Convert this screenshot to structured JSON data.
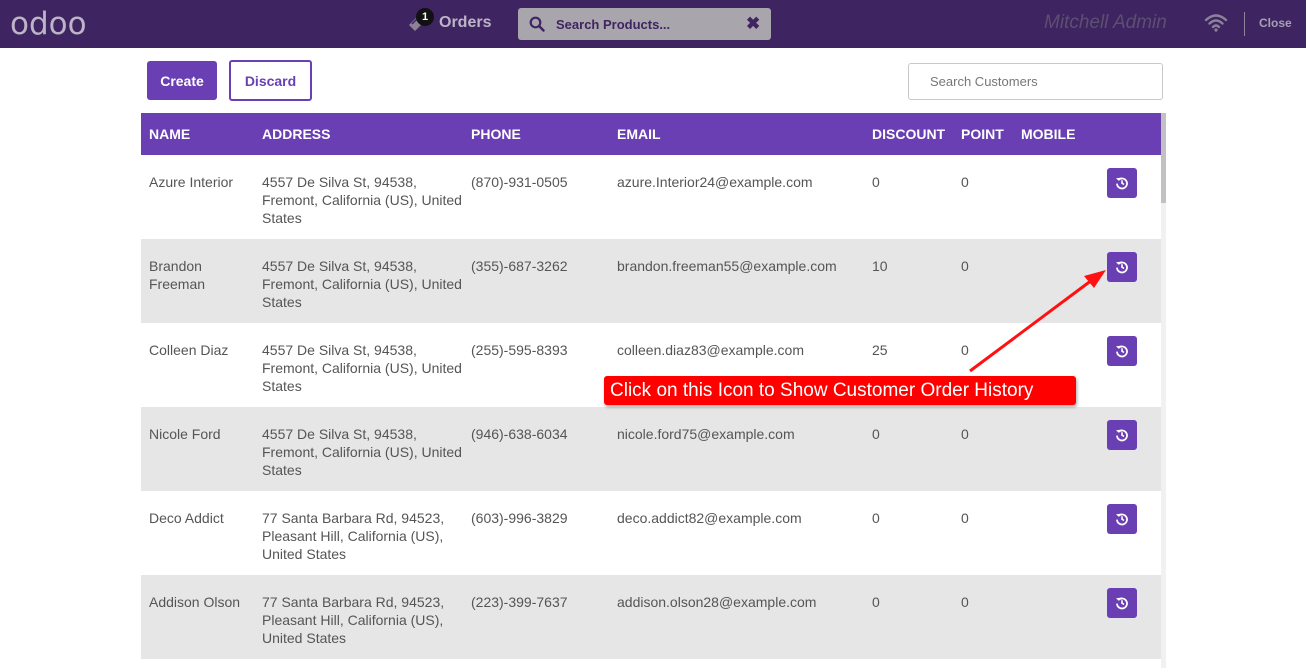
{
  "topbar": {
    "logo": "odoo",
    "orders_count": "1",
    "orders_label": "Orders",
    "search_products_placeholder": "Search Products...",
    "cashier": "Mitchell Admin",
    "close_label": "Close"
  },
  "controls": {
    "create_label": "Create",
    "discard_label": "Discard",
    "search_customers_placeholder": "Search Customers"
  },
  "table": {
    "headers": [
      "NAME",
      "ADDRESS",
      "PHONE",
      "EMAIL",
      "DISCOUNT",
      "POINT",
      "MOBILE"
    ],
    "rows": [
      {
        "name": "Azure Interior",
        "address": "4557 De Silva St, 94538, Fremont, California (US), United States",
        "phone": "(870)-931-0505",
        "email": "azure.Interior24@example.com",
        "discount": "0",
        "point": "0",
        "mobile": ""
      },
      {
        "name": "Brandon Freeman",
        "address": "4557 De Silva St, 94538, Fremont, California (US), United States",
        "phone": "(355)-687-3262",
        "email": "brandon.freeman55@example.com",
        "discount": "10",
        "point": "0",
        "mobile": ""
      },
      {
        "name": "Colleen Diaz",
        "address": "4557 De Silva St, 94538, Fremont, California (US), United States",
        "phone": "(255)-595-8393",
        "email": "colleen.diaz83@example.com",
        "discount": "25",
        "point": "0",
        "mobile": ""
      },
      {
        "name": "Nicole Ford",
        "address": "4557 De Silva St, 94538, Fremont, California (US), United States",
        "phone": "(946)-638-6034",
        "email": "nicole.ford75@example.com",
        "discount": "0",
        "point": "0",
        "mobile": ""
      },
      {
        "name": "Deco Addict",
        "address": "77 Santa Barbara Rd, 94523, Pleasant Hill, California (US), United States",
        "phone": "(603)-996-3829",
        "email": "deco.addict82@example.com",
        "discount": "0",
        "point": "0",
        "mobile": ""
      },
      {
        "name": "Addison Olson",
        "address": "77 Santa Barbara Rd, 94523, Pleasant Hill, California (US), United States",
        "phone": "(223)-399-7637",
        "email": "addison.olson28@example.com",
        "discount": "0",
        "point": "0",
        "mobile": ""
      }
    ]
  },
  "annotation": {
    "text": "Click on this Icon to Show Customer Order History"
  },
  "colors": {
    "topbar": "#3e2460",
    "accent": "#6a3fb3",
    "annotation": "#ff0000"
  },
  "icons": {
    "orders": "ticket-icon",
    "search": "search-icon",
    "clear": "close-icon",
    "wifi": "wifi-icon",
    "history": "history-icon"
  }
}
